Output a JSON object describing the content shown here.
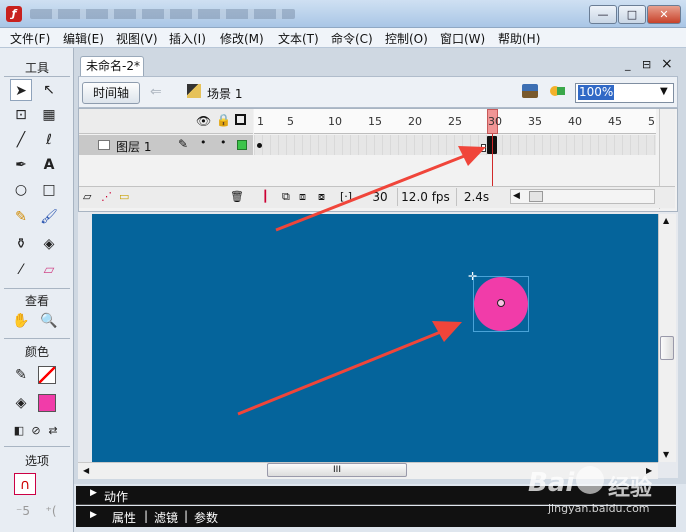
{
  "window": {
    "title": "",
    "buttons": {
      "minimize": "—",
      "maximize": "□",
      "close": "✕"
    },
    "app_icon": "ƒ"
  },
  "menu": [
    "文件(F)",
    "编辑(E)",
    "视图(V)",
    "插入(I)",
    "修改(M)",
    "文本(T)",
    "命令(C)",
    "控制(O)",
    "窗口(W)",
    "帮助(H)"
  ],
  "toolbox": {
    "title": "工具",
    "view_label": "查看",
    "color_label": "颜色",
    "options_label": "选项",
    "stroke_color": "#ff0000",
    "fill_color": "#f13ca9"
  },
  "document": {
    "tab_title": "未命名-2*",
    "controls": {
      "minimize": "_",
      "restore": "⊟",
      "close": "×"
    }
  },
  "editbar": {
    "timeline_button": "时间轴",
    "scene": "场景 1",
    "zoom": "100%"
  },
  "timeline": {
    "ruler": [
      "1",
      "5",
      "10",
      "15",
      "20",
      "25",
      "30",
      "35",
      "40",
      "45",
      "5"
    ],
    "current_frame": "30",
    "fps": "12.0 fps",
    "time": "2.4s",
    "layers": [
      {
        "name": "图层 1",
        "visible": "•",
        "locked": "•",
        "outline_color": "#3cc44a"
      }
    ]
  },
  "stage": {
    "background": "#05649b",
    "circle_color": "#f13ca9",
    "scroll_thumb": "III"
  },
  "panels": {
    "actions": "动作",
    "properties": "属性",
    "filters": "滤镜",
    "parameters": "参数"
  },
  "watermark": {
    "brand": "Bai",
    "brand2": "经验",
    "url": "jingyan.baidu.com"
  }
}
